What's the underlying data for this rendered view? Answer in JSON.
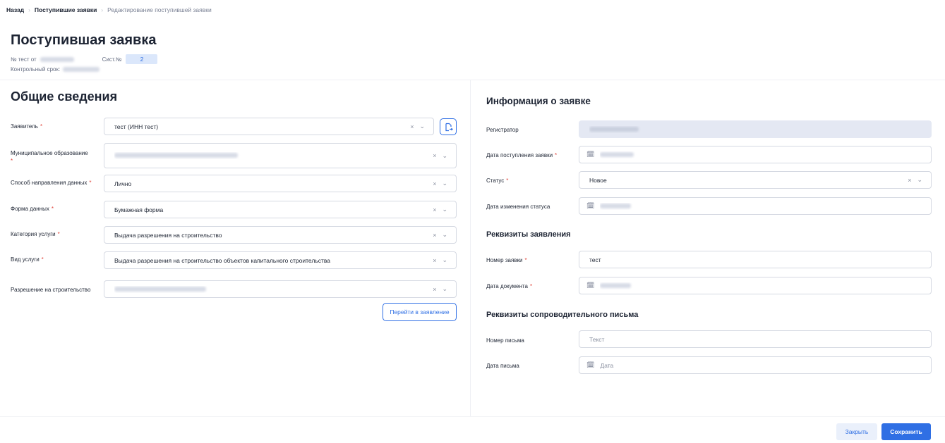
{
  "breadcrumb": {
    "back": "Назад",
    "parent": "Поступившие заявки",
    "current": "Редактирование поступившей заявки"
  },
  "header": {
    "title": "Поступившая заявка",
    "number_label": "№ тест от",
    "sys_label": "Сист.№",
    "sys_value": "2",
    "deadline_label": "Контрольный срок:"
  },
  "general": {
    "title": "Общие сведения",
    "fields": [
      {
        "label": "Заявитель",
        "value": "тест (ИНН тест)"
      },
      {
        "label": "Муниципальное образование",
        "value": ""
      },
      {
        "label": "Способ направления данных",
        "value": "Лично"
      },
      {
        "label": "Форма данных",
        "value": "Бумажная форма"
      },
      {
        "label": "Категория услуги",
        "value": "Выдача разрешения на строительство"
      },
      {
        "label": "Вид услуги",
        "value": "Выдача разрешения на строительство объектов капитального строительства"
      },
      {
        "label": "Разрешение на строительство",
        "value": ""
      }
    ],
    "goto_button": "Перейти в заявление"
  },
  "info": {
    "title": "Информация о заявке",
    "registrar_label": "Регистратор",
    "received_label": "Дата поступления заявки",
    "status_label": "Статус",
    "status_value": "Новое",
    "status_changed_label": "Дата изменения статуса"
  },
  "requisites": {
    "title": "Реквизиты заявления",
    "number_label": "Номер заявки",
    "number_value": "тест",
    "date_label": "Дата документа"
  },
  "letter": {
    "title": "Реквизиты сопроводительного письма",
    "number_label": "Номер письма",
    "number_placeholder": "Текст",
    "date_label": "Дата письма",
    "date_placeholder": "Дата"
  },
  "footer": {
    "close": "Закрыть",
    "save": "Сохранить"
  },
  "icons": {
    "clear": "×",
    "chevron": "⌄",
    "calendar": "calendar-icon",
    "document": "document-arrow-icon"
  },
  "colors": {
    "accent": "#2f6fe4",
    "required": "#e0453b",
    "disabled_bg": "#e4e8f3"
  }
}
